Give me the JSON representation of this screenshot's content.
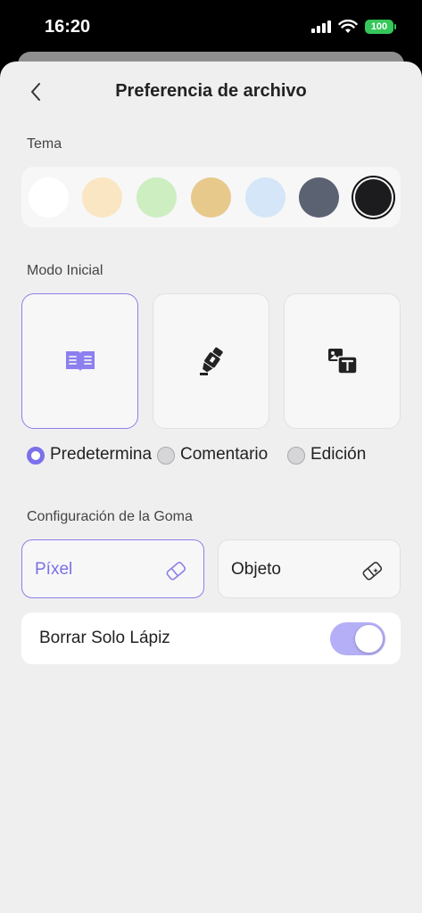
{
  "status_bar": {
    "time": "16:20",
    "battery": "100"
  },
  "header": {
    "title": "Preferencia de archivo",
    "back_icon": "chevron-left-icon"
  },
  "theme": {
    "label": "Tema",
    "swatches": [
      "#ffffff",
      "#fbe6c3",
      "#cdeec0",
      "#e8c98c",
      "#d4e6f7",
      "#5b6272",
      "#1c1c1e"
    ],
    "selected_index": 6
  },
  "initial_mode": {
    "label": "Modo Inicial",
    "options": [
      {
        "label": "Predetermina",
        "icon": "open-book-icon"
      },
      {
        "label": "Comentario",
        "icon": "highlighter-icon"
      },
      {
        "label": "Edición",
        "icon": "image-text-icon"
      }
    ],
    "selected_index": 0
  },
  "eraser": {
    "label": "Configuración de la Goma",
    "options": [
      {
        "label": "Píxel",
        "icon": "eraser-icon"
      },
      {
        "label": "Objeto",
        "icon": "object-eraser-icon"
      }
    ],
    "selected_index": 0
  },
  "pencil_only": {
    "label": "Borrar Solo Lápiz",
    "enabled": true
  },
  "colors": {
    "accent": "#7c70ea",
    "toggle_on": "#b4aff6"
  }
}
